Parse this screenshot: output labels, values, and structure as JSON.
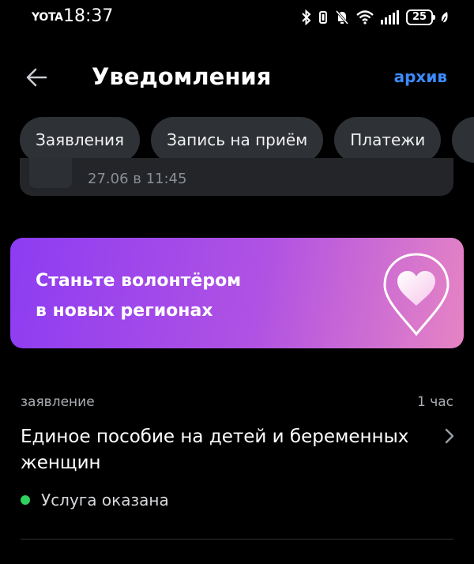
{
  "status_bar": {
    "carrier": "YOTA",
    "time": "18:37",
    "battery": "25",
    "icons": [
      "bluetooth-icon",
      "vibrate-icon",
      "mute-icon",
      "wifi-icon",
      "signal-icon",
      "battery-icon",
      "leaf-icon"
    ]
  },
  "header": {
    "title": "Уведомления",
    "archive_label": "архив",
    "back_icon": "arrow-left-icon"
  },
  "tabs": [
    {
      "label": "Заявления"
    },
    {
      "label": "Запись на приём"
    },
    {
      "label": "Платежи"
    }
  ],
  "partial_card": {
    "date": "27.06 в 11:45"
  },
  "promo": {
    "line1": "Станьте волонтёром",
    "line2": "в новых регионах",
    "icon": "heart-pin-icon"
  },
  "notification": {
    "type": "заявление",
    "time": "1 час",
    "title": "Единое пособие на детей и беременных женщин",
    "status": "Услуга оказана",
    "status_color": "#2fd25c"
  },
  "colors": {
    "accent": "#3d8bff",
    "background": "#000000",
    "chip": "#2e3136"
  }
}
